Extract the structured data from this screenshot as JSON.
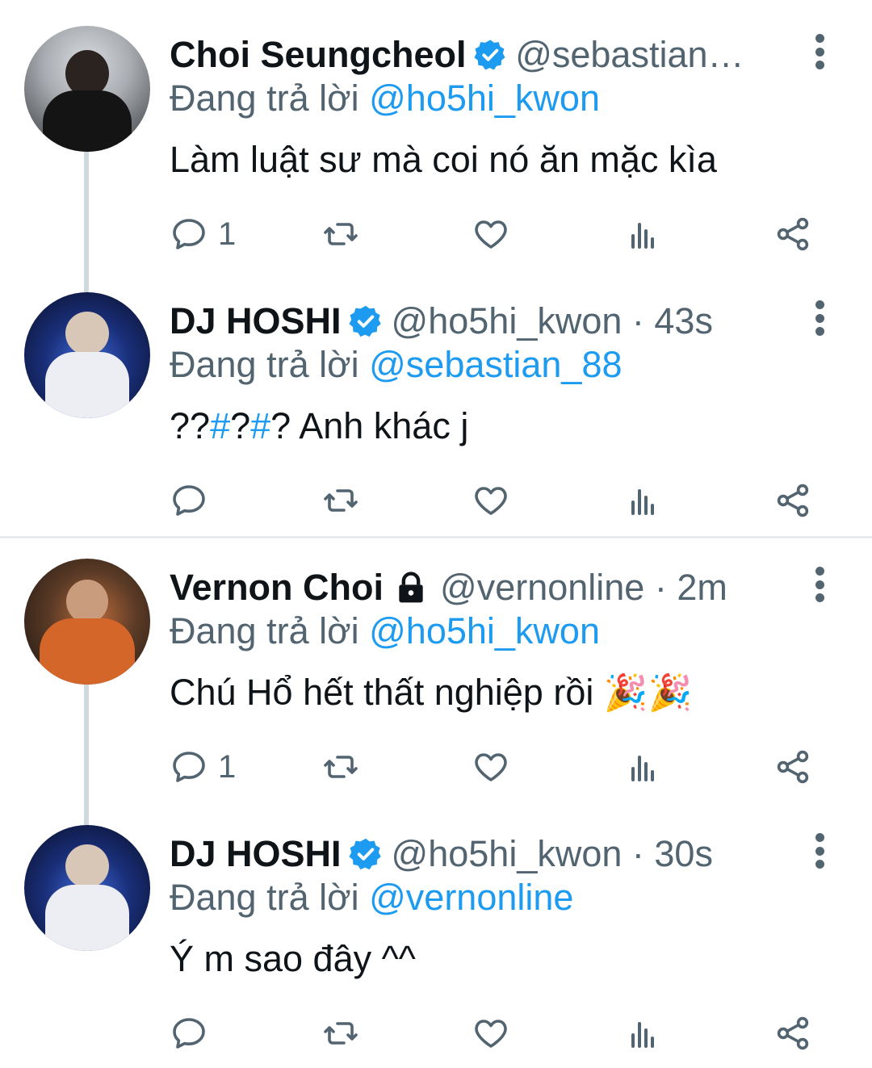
{
  "tweets": [
    {
      "name": "Choi Seungcheol",
      "handle_time": "@sebastian_...",
      "reply_prefix": "Đang trả lời ",
      "reply_to": "@ho5hi_kwon",
      "text": "Làm luật sư mà coi nó ăn mặc kìa",
      "reply_count": "1",
      "verified": true
    },
    {
      "name": "DJ HOSHI",
      "handle_time": "@ho5hi_kwon · 43s",
      "reply_prefix": "Đang trả lời ",
      "reply_to": "@sebastian_88",
      "text_parts": [
        "??",
        "#",
        "?",
        "#",
        "? Anh khác j"
      ],
      "reply_count": "",
      "verified": true
    },
    {
      "name": "Vernon Choi",
      "handle_time": "@vernonline · 2m",
      "reply_prefix": "Đang trả lời ",
      "reply_to": "@ho5hi_kwon",
      "text": "Chú Hổ hết thất nghiệp rồi ",
      "emoji": "🎉🎉",
      "reply_count": "1",
      "protected": true
    },
    {
      "name": "DJ HOSHI",
      "handle_time": "@ho5hi_kwon · 30s",
      "reply_prefix": "Đang trả lời ",
      "reply_to": "@vernonline",
      "text": "Ý m sao đây ^^",
      "reply_count": "",
      "verified": true
    }
  ],
  "icons": {
    "reply": "reply-icon",
    "retweet": "retweet-icon",
    "like": "heart-icon",
    "views": "analytics-icon",
    "share": "share-icon",
    "more": "more-options-icon",
    "verified": "verified-badge-icon",
    "protected": "lock-icon"
  },
  "colors": {
    "link": "#1d9bf0",
    "secondary": "#536471",
    "text": "#0f1419",
    "thread_line": "#cfd9de"
  }
}
